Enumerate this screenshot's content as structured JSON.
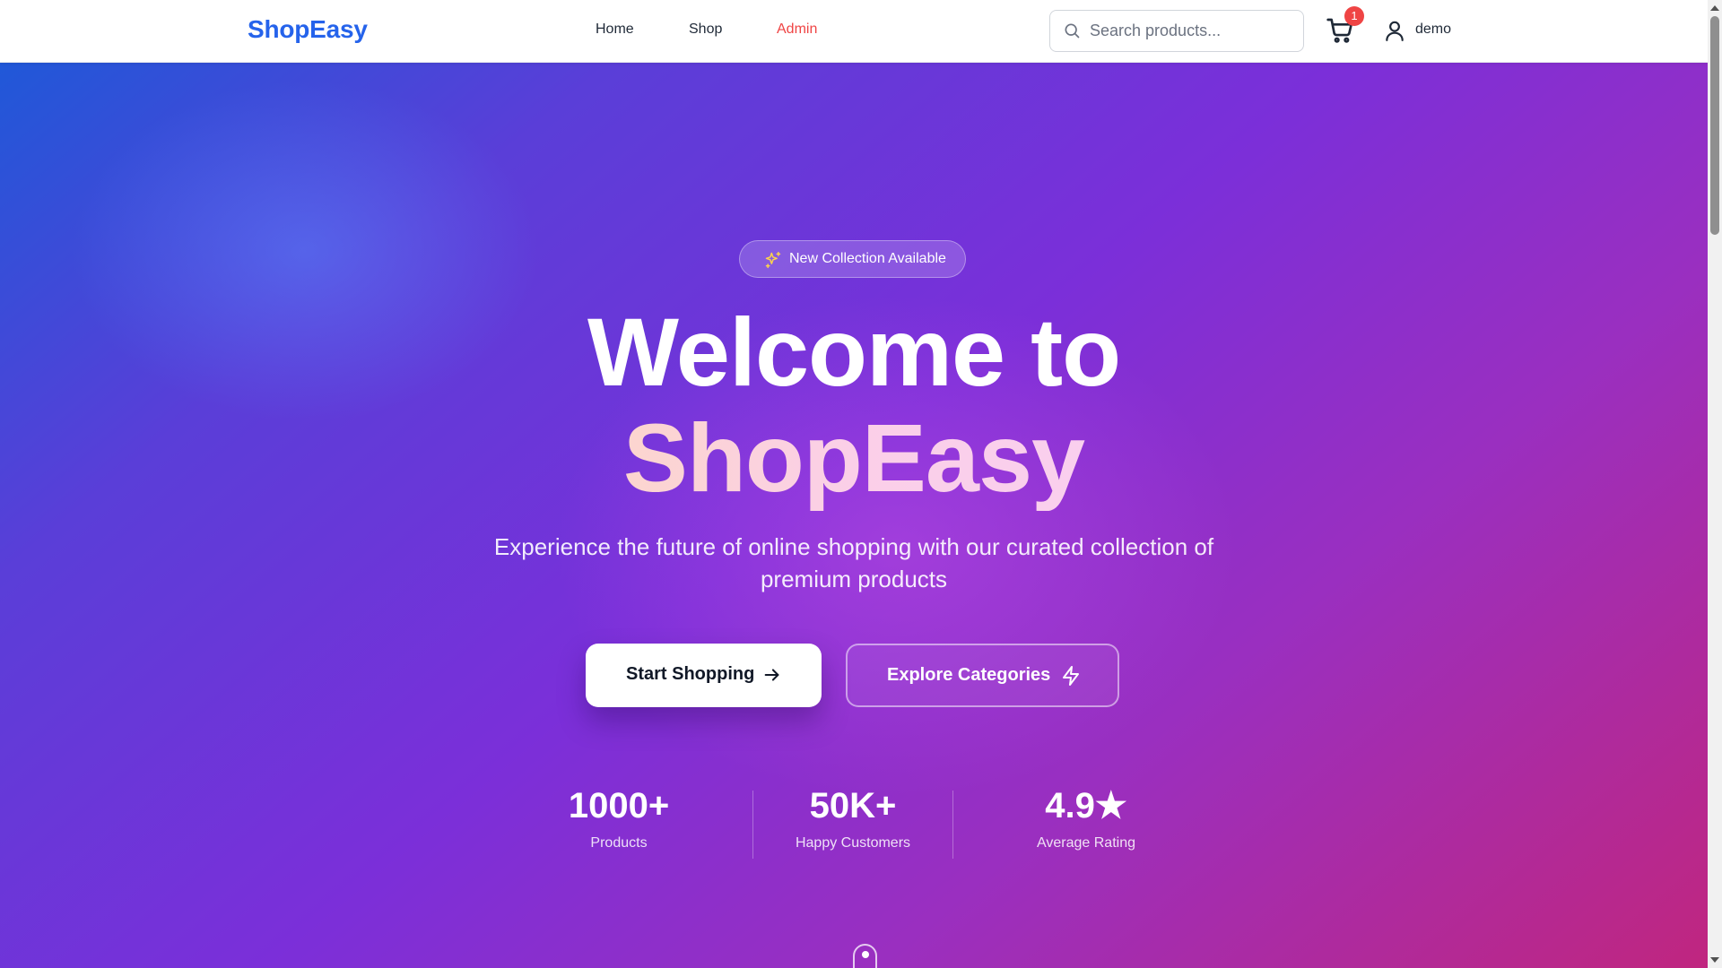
{
  "header": {
    "logo": "ShopEasy",
    "nav": [
      {
        "label": "Home"
      },
      {
        "label": "Shop"
      },
      {
        "label": "Admin",
        "color": "#ef4444"
      }
    ],
    "search": {
      "placeholder": "Search products...",
      "value": "",
      "icon": "search-icon"
    },
    "cart": {
      "icon": "cart-icon",
      "badge": "1"
    },
    "user": {
      "icon": "user-icon",
      "name": "demo"
    }
  },
  "hero": {
    "badge": {
      "icon": "sparkles-icon",
      "text": "New Collection Available"
    },
    "title_line1": "Welcome to",
    "title_line2": "ShopEasy",
    "subtitle": "Experience the future of online shopping with our curated collection of premium products",
    "primary_button": {
      "label": "Start Shopping",
      "icon": "arrow-right-icon"
    },
    "secondary_button": {
      "label": "Explore Categories",
      "icon": "lightning-icon"
    },
    "stats": [
      {
        "value": "1000+",
        "label": "Products"
      },
      {
        "value": "50K+",
        "label": "Happy Customers"
      },
      {
        "value": "4.9★",
        "label": "Average Rating"
      }
    ],
    "scroll_indicator": "mouse-scroll-icon"
  },
  "colors": {
    "brand": "#2563eb",
    "admin_link": "#ef4444",
    "badge": "#ef4444",
    "gradient_start": "#2058d8",
    "gradient_mid": "#7b2fd9",
    "gradient_end": "#c0267f",
    "title_highlight_start": "#fde68a",
    "title_highlight_end": "#f5d0fe"
  }
}
